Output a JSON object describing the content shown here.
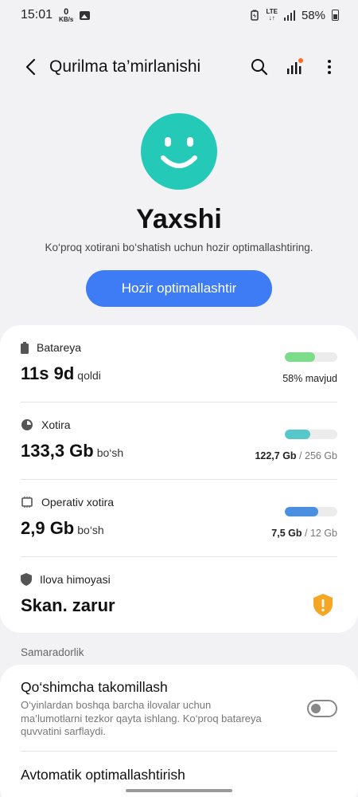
{
  "status_bar": {
    "time": "15:01",
    "net_speed_value": "0",
    "net_speed_unit": "KB/s",
    "network": "LTE",
    "battery_percent": "58%"
  },
  "app_bar": {
    "title": "Qurilma ta’mirlanishi",
    "back_icon": "arrow-back",
    "search_icon": "search",
    "stats_icon": "bar-chart",
    "more_icon": "more-vertical"
  },
  "hero": {
    "status": "Yaxshi",
    "subtitle": "Ko‘proq xotirani bo‘shatish uchun hozir optimallashtiring.",
    "button_label": "Hozir optimallashtir",
    "face_color": "#24c9b7"
  },
  "rows": {
    "battery": {
      "label": "Batareya",
      "value": "11s 9d",
      "unit": "qoldi",
      "bar_text": "58% mavjud",
      "fill_fraction": 0.58,
      "color": "#7ddc8a"
    },
    "storage": {
      "label": "Xotira",
      "value": "133,3 Gb",
      "unit": "bo‘sh",
      "used": "122,7 Gb",
      "total": "/ 256 Gb",
      "fill_fraction": 0.48,
      "color": "#56c8cc"
    },
    "ram": {
      "label": "Operativ xotira",
      "value": "2,9 Gb",
      "unit": "bo‘sh",
      "used": "7,5 Gb",
      "total": "/ 12 Gb",
      "fill_fraction": 0.63,
      "color": "#4a8fe0"
    },
    "app_protection": {
      "label": "Ilova himoyasi",
      "value": "Skan. zarur",
      "warn_color": "#f5a623"
    }
  },
  "section": {
    "label": "Samaradorlik",
    "items": [
      {
        "title": "Qo‘shimcha takomillash",
        "desc": "O‘yinlardan boshqa barcha ilovalar uchun ma’lumotlarni tezkor qayta ishlang. Ko‘proq batareya quvvatini sarflaydi.",
        "toggle_on": false
      },
      {
        "title": "Avtomatik optimallashtirish"
      }
    ]
  }
}
